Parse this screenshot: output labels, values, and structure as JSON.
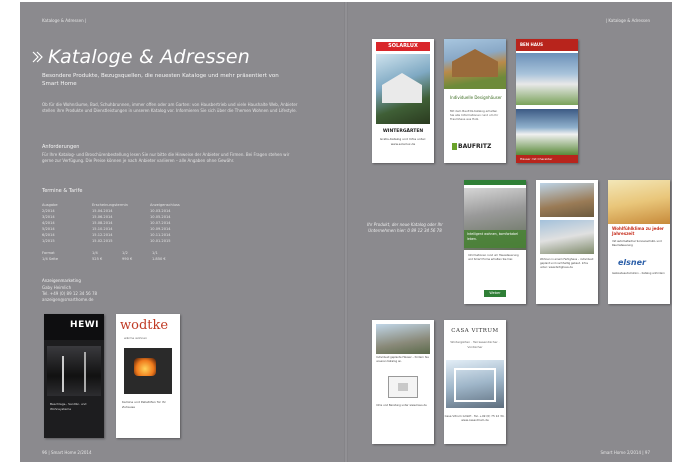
{
  "left_page": {
    "running_head": "Kataloge & Adressen |",
    "title": "Kataloge & Adressen",
    "subtitle": "Besondere Produkte, Bezugsquellen, die neuesten Kataloge und mehr präsentiert von Smart Home",
    "intro": "Ob für die Wohnräume, Bad, Schuhbrunnen, immer offen oder am Garten: von Hausbertrieb und viele Haushalte Web, Anbieter stellen ihre Produkte und Dienstleistungen in unseren Katalog vor. Informieren Sie sich über die Themen Wohnen und Lifestyle.",
    "notes_heading": "Anforderungen",
    "notes_text": "Für Ihre Katalog- und Broschürenbestellung lesen Sie nur bitte die Hinweise der Anbieter und Firmen. Bei Fragen stehen wir gerne zur Verfügung. Die Preise können je nach Anbieter variieren – alle Angaben ohne Gewähr.",
    "tariff_heading": "Termine & Tarife",
    "table_header": [
      "Ausgabe",
      "Erscheinungstermin",
      "Anzeigenschluss"
    ],
    "table_rows": [
      [
        "2/2014",
        "15.04.2014",
        "10.03.2014"
      ],
      [
        "3/2014",
        "15.06.2014",
        "10.05.2014"
      ],
      [
        "4/2014",
        "15.08.2014",
        "10.07.2014"
      ],
      [
        "5/2014",
        "15.10.2014",
        "10.09.2014"
      ],
      [
        "6/2014",
        "15.12.2014",
        "10.11.2014"
      ],
      [
        "1/2015",
        "15.02.2015",
        "10.01.2015"
      ]
    ],
    "price_rows": [
      [
        "Format",
        "1/4",
        "1/2",
        "1/1"
      ],
      [
        "1/4 Seite",
        "525 €",
        "990 €",
        "1.850 €"
      ]
    ],
    "contact_heading": "Anzeigenmarketing",
    "contact_lines": [
      "Gaby Heimlich",
      "Tel. +49 (0) 89 12 34 56 78",
      "anzeigen@smarthome.de"
    ],
    "hewi": {
      "logo": "HEWI",
      "caption": "Beschlags-, Sanitär- und Wohnsysteme"
    },
    "wodtke": {
      "logo": "wodtke",
      "sub": "wärme wohnen",
      "text": "Kamine und Pelletöfen für Ihr Zuhause"
    },
    "page_number": "96 | Smart Home 2/2014"
  },
  "right_page": {
    "running_head": "| Kataloge & Adressen",
    "solarlux": {
      "logo": "SOLARLUX",
      "title": "WINTERGÄRTEN",
      "text": "Gratis-Katalog und Infos unter: www.solarlux.de"
    },
    "baufritz": {
      "headline": "Individuelle Designhäuser",
      "text": "Mit dem Baufritz-Katalog erhalten Sie alle Informationen rund um Ihr Traumhaus aus Holz.",
      "logo": "BAUFRITZ"
    },
    "bauhaus": {
      "logo": "BEN HAUS",
      "footer": "Häuser mit Charakter"
    },
    "mid_caption": "Ihr Produkt, der neue Katalog oder Ihr Unternehmen hier: 0 89 12 34 56 78",
    "wohnen": {
      "band": "Intelligent wohnen, komfortabel leben.",
      "text": "Informationen rund um Haussteuerung und Smart Home erhalten Sie hier.",
      "logo": "Weber"
    },
    "rohn": {
      "text": "Wohnen in einem Fertighaus – individuell geplant und nachhaltig gebaut. Infos unter: www.fertighaus.de"
    },
    "elsner": {
      "headline": "Wohlfühlklima zu jeder Jahreszeit",
      "text": "mit automatischer Sonnenschutz- und Raumsteuerung",
      "logo": "elsner",
      "text2": "Gebäudeautomation – Katalog anfordern"
    },
    "doc": {
      "text": "Individuell geplante Häuser – fordern Sie unseren Katalog an.",
      "text2": "Infos und Beratung unter www.haus.de"
    },
    "vitrum": {
      "logo": "CASA VITRUM",
      "sub": "Wintergärten · Terrassendächer · Vordächer",
      "text": "Casa Vitrum GmbH · Tel. +49 (0) 75 12 34 · www.casavitrum.de"
    },
    "page_number": "Smart Home 2/2014 | 97"
  },
  "colors": {
    "page_bg": "#8b8a8e",
    "text": "#f2f2f2",
    "solarlux_red": "#d9262a",
    "elsner_blue": "#2a5ea8"
  }
}
